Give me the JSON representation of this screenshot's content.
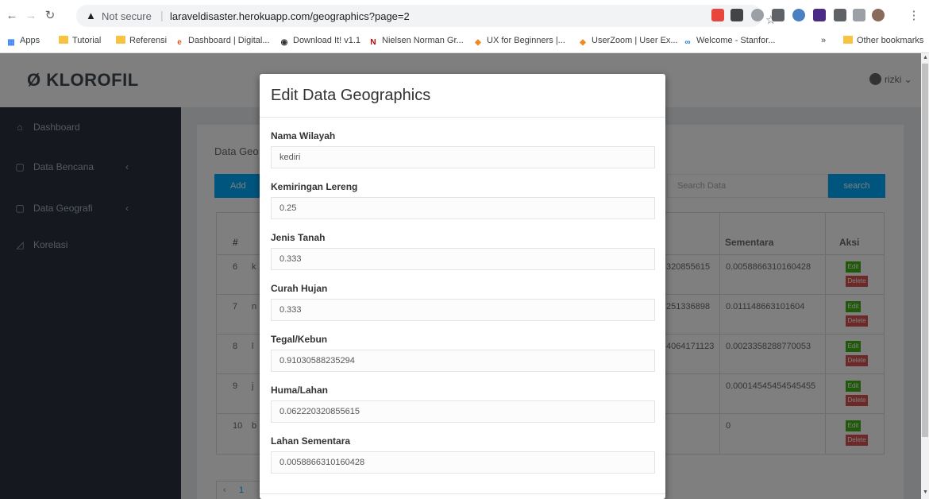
{
  "browser": {
    "not_secure": "Not secure",
    "url": "laraveldisaster.herokuapp.com/geographics?page=2",
    "bookmarks": [
      "Apps",
      "Tutorial",
      "Referensi",
      "Dashboard | Digital...",
      "Download It! v1.1",
      "Nielsen Norman Gr...",
      "UX for Beginners |...",
      "UserZoom | User Ex...",
      "Welcome - Stanfor..."
    ],
    "more_bookmarks": "»",
    "other_bookmarks": "Other bookmarks"
  },
  "app": {
    "logo": "KLOROFIL",
    "user": "rizki"
  },
  "sidebar": {
    "items": [
      {
        "label": "Dashboard",
        "icon": "home-icon"
      },
      {
        "label": "Data Bencana",
        "icon": "file-icon"
      },
      {
        "label": "Data Geografi",
        "icon": "file-icon"
      },
      {
        "label": "Korelasi",
        "icon": "chart-icon"
      }
    ]
  },
  "panel": {
    "title": "Data Geo",
    "add_label": "Add",
    "search_placeholder": "Search Data",
    "search_label": "search",
    "headers": {
      "no": "#",
      "sementara": "Sementara",
      "aksi": "Aksi"
    },
    "rows": [
      {
        "no": "6",
        "c1": "k",
        "c2": "320855615",
        "sementara": "0.0058866310160428"
      },
      {
        "no": "7",
        "c1": "n",
        "c2": "251336898",
        "sementara": "0.011148663101604"
      },
      {
        "no": "8",
        "c1": "l",
        "c2": "4064171123",
        "sementara": "0.0023358288770053"
      },
      {
        "no": "9",
        "c1": "j",
        "c2": "",
        "sementara": "0.00014545454545455"
      },
      {
        "no": "10",
        "c1": "b",
        "c2": "",
        "sementara": "0"
      }
    ],
    "edit_label": "Edit",
    "delete_label": "Delete",
    "pager": {
      "prev": "‹",
      "page": "1"
    }
  },
  "modal": {
    "title": "Edit Data Geographics",
    "fields": [
      {
        "label": "Nama Wilayah",
        "value": "kediri"
      },
      {
        "label": "Kemiringan Lereng",
        "value": "0.25"
      },
      {
        "label": "Jenis Tanah",
        "value": "0.333"
      },
      {
        "label": "Curah Hujan",
        "value": "0.333"
      },
      {
        "label": "Tegal/Kebun",
        "value": "0.91030588235294"
      },
      {
        "label": "Huma/Lahan",
        "value": "0.062220320855615"
      },
      {
        "label": "Lahan Sementara",
        "value": "0.0058866310160428"
      }
    ]
  }
}
